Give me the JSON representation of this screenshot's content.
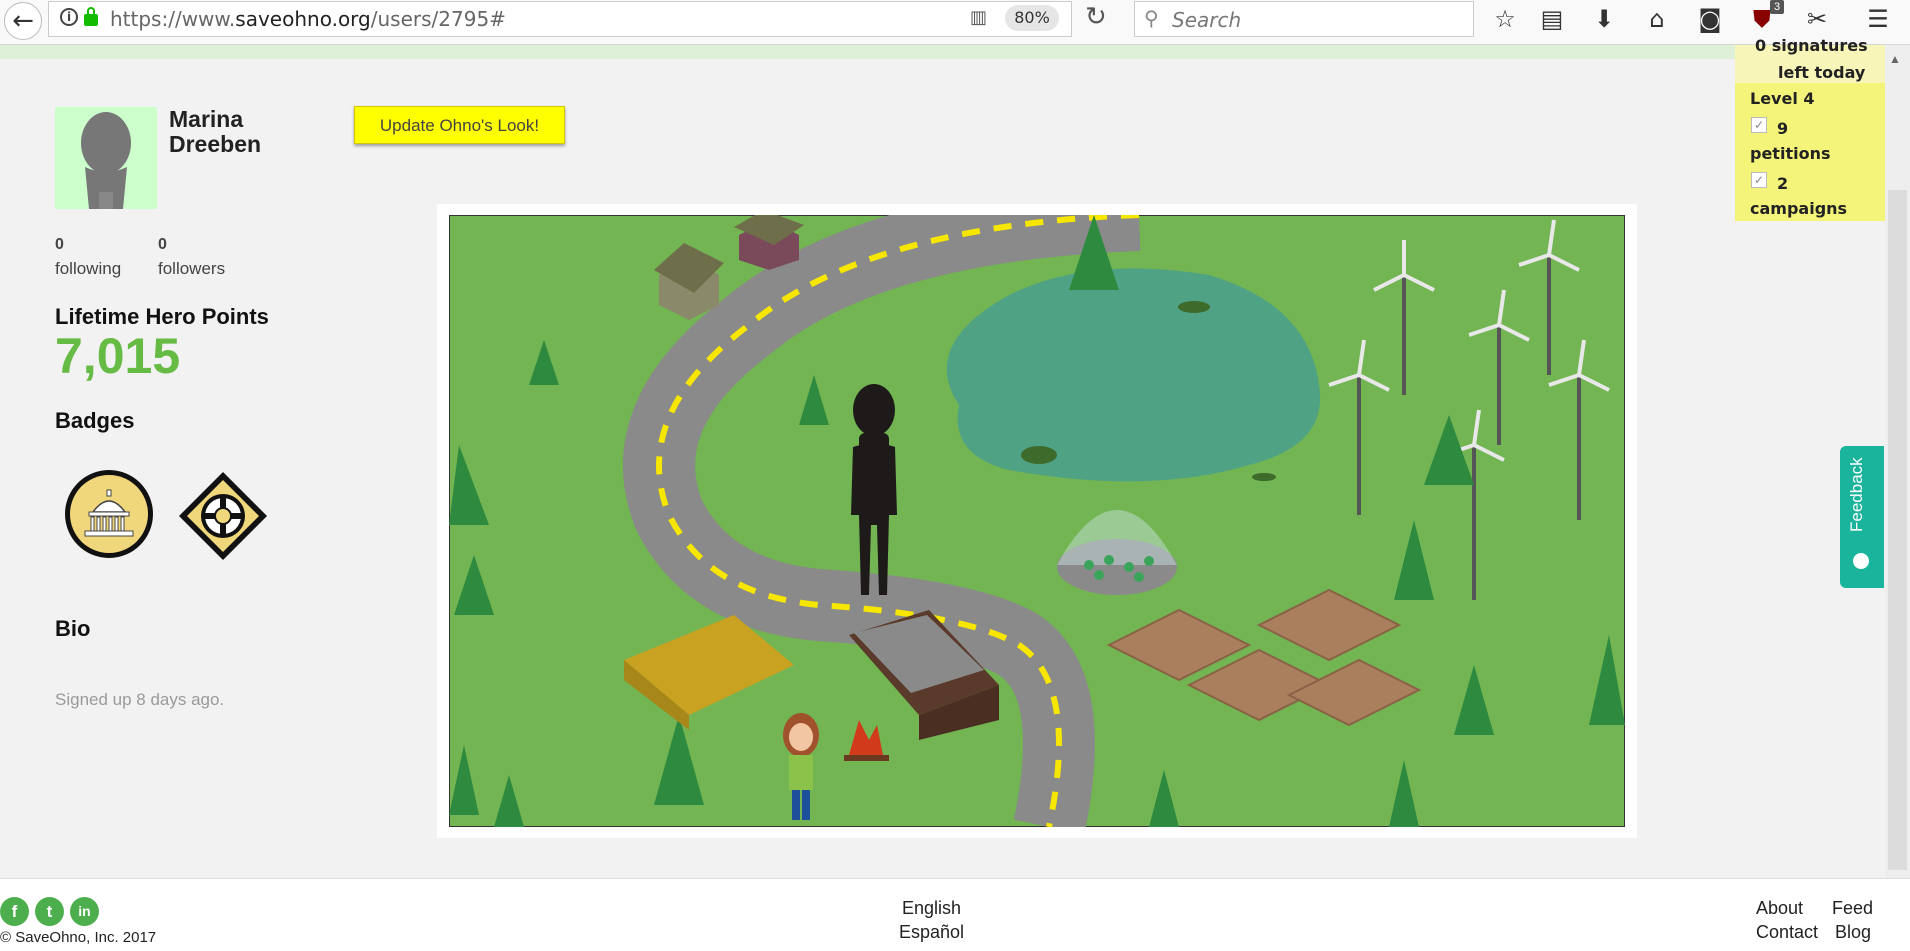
{
  "browser": {
    "url_prefix": "https://www.",
    "url_domain": "saveohno.org",
    "url_path": "/users/2795#",
    "zoom": "80%",
    "search_placeholder": "Search",
    "ublock_count": "3"
  },
  "petition_box": {
    "top_line1": "0 signatures",
    "top_line2": "left today",
    "level": "Level 4",
    "petitions_count": "9",
    "petitions_label": "petitions",
    "campaigns_count": "2",
    "campaigns_label": "campaigns"
  },
  "profile": {
    "first_name": "Marina",
    "last_name": "Dreeben",
    "update_button": "Update Ohno's Look!",
    "following_count": "0",
    "following_label": "following",
    "followers_count": "0",
    "followers_label": "followers",
    "hero_points_label": "Lifetime Hero Points",
    "hero_points_value": "7,015",
    "badges_heading": "Badges",
    "bio_heading": "Bio",
    "signed_up": "Signed up 8 days ago."
  },
  "feedback_tab": "Feedback",
  "footer": {
    "social": [
      "f",
      "t",
      "in"
    ],
    "copyright": "© SaveOhno, Inc. 2017",
    "lang_english": "English",
    "lang_espanol": "Español",
    "link_about": "About",
    "link_feed": "Feed",
    "link_contact": "Contact",
    "link_blog": "Blog"
  },
  "colors": {
    "brand_green": "#66bb44",
    "highlight_yellow": "#ffff00",
    "feedback_teal": "#1ab39b"
  }
}
